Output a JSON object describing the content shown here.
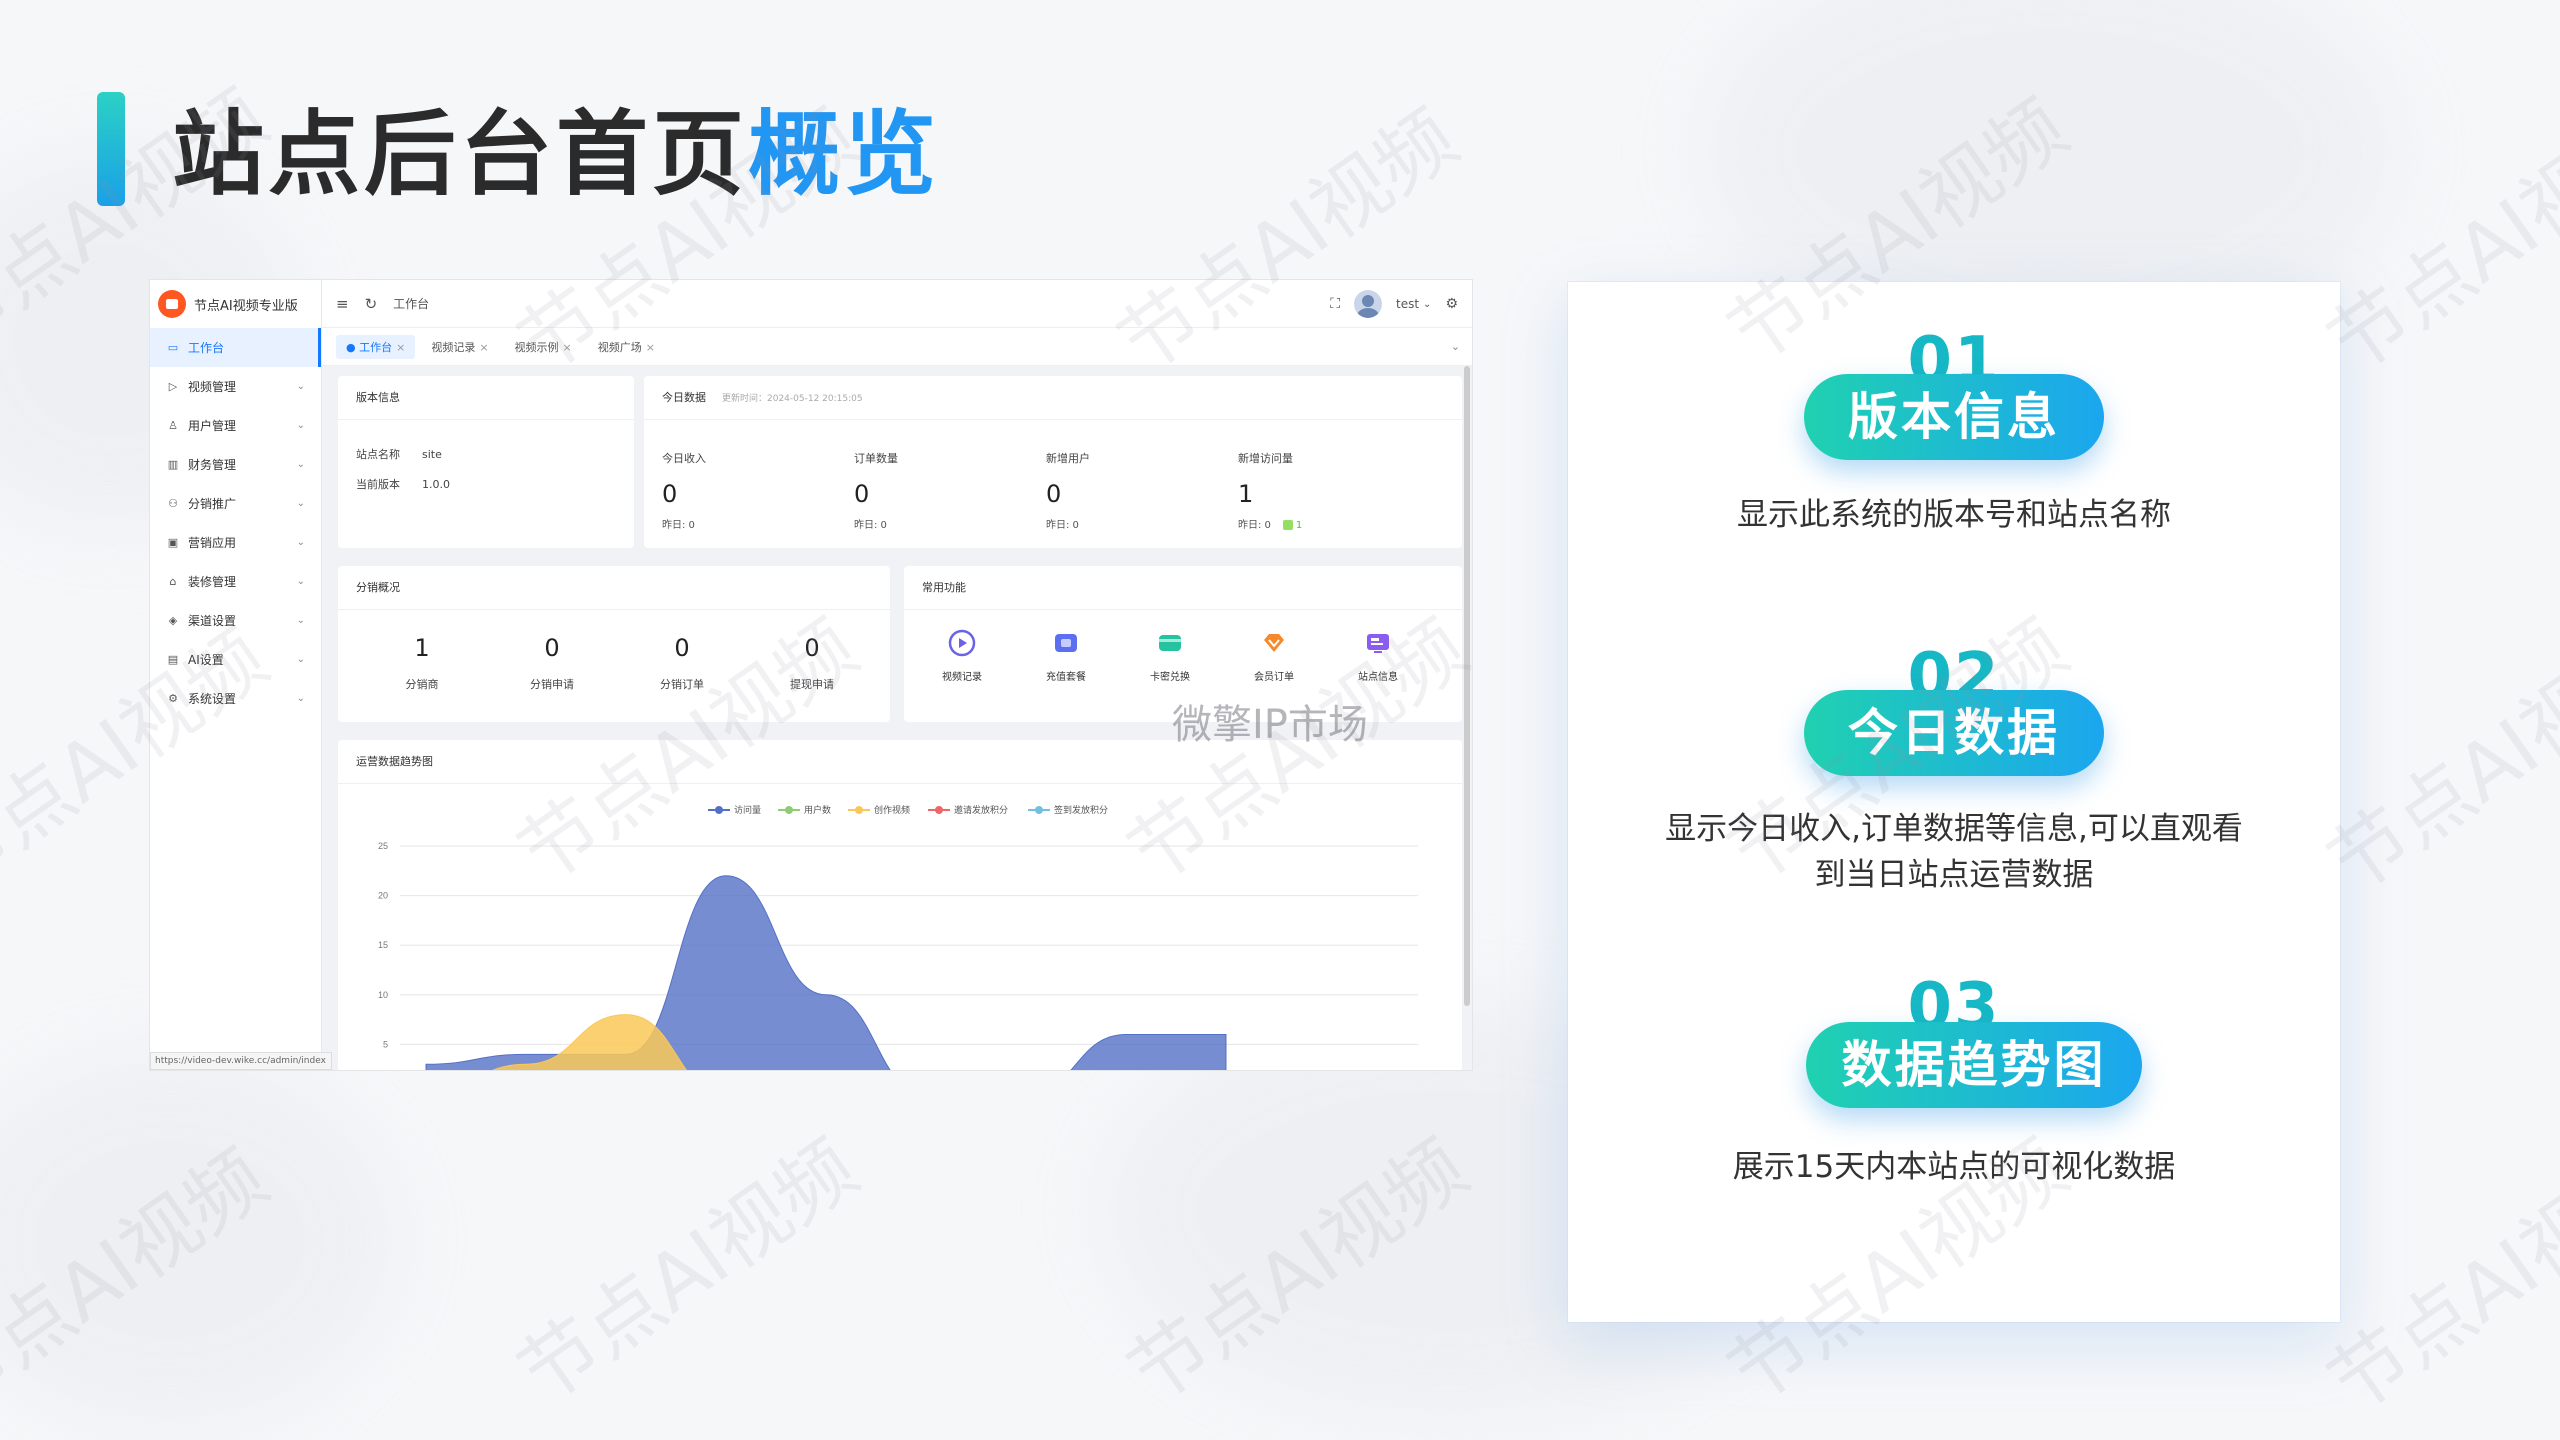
{
  "slide": {
    "title_main": "站点后台首页",
    "title_highlight": "概览",
    "watermark": "节点AI视频",
    "center_watermark": "微擎IP市场"
  },
  "admin": {
    "brand": "节点AI视频专业版",
    "menu": [
      {
        "label": "工作台",
        "icon": "monitor-icon",
        "active": true
      },
      {
        "label": "视频管理",
        "icon": "video-icon"
      },
      {
        "label": "用户管理",
        "icon": "user-icon"
      },
      {
        "label": "财务管理",
        "icon": "finance-icon"
      },
      {
        "label": "分销推广",
        "icon": "share-icon"
      },
      {
        "label": "营销应用",
        "icon": "gift-icon"
      },
      {
        "label": "装修管理",
        "icon": "decorate-icon"
      },
      {
        "label": "渠道设置",
        "icon": "channel-icon"
      },
      {
        "label": "AI设置",
        "icon": "ai-icon"
      },
      {
        "label": "系统设置",
        "icon": "gear-icon"
      }
    ],
    "url": "https://video-dev.wike.cc/admin/index",
    "topbar": {
      "breadcrumb": "工作台",
      "user": "test"
    },
    "tabs": [
      {
        "label": "工作台",
        "active": true
      },
      {
        "label": "视频记录"
      },
      {
        "label": "视频示例"
      },
      {
        "label": "视频广场"
      }
    ],
    "version_card": {
      "title": "版本信息",
      "site_name_label": "站点名称",
      "site_name": "site",
      "version_label": "当前版本",
      "version": "1.0.0"
    },
    "today_card": {
      "title": "今日数据",
      "updated": "更新时间：2024-05-12 20:15:05",
      "stats": [
        {
          "label": "今日收入",
          "value": "0",
          "yesterday": "昨日: 0"
        },
        {
          "label": "订单数量",
          "value": "0",
          "yesterday": "昨日: 0"
        },
        {
          "label": "新增用户",
          "value": "0",
          "yesterday": "昨日: 0"
        },
        {
          "label": "新增访问量",
          "value": "1",
          "yesterday": "昨日: 0",
          "delta": "1"
        }
      ]
    },
    "dist_card": {
      "title": "分销概况",
      "items": [
        {
          "value": "1",
          "label": "分销商"
        },
        {
          "value": "0",
          "label": "分销申请"
        },
        {
          "value": "0",
          "label": "分销订单"
        },
        {
          "value": "0",
          "label": "提现申请"
        }
      ]
    },
    "func_card": {
      "title": "常用功能",
      "items": [
        {
          "label": "视频记录",
          "icon": "play-icon",
          "color": "#6b63e6"
        },
        {
          "label": "充值套餐",
          "icon": "package-icon",
          "color": "#5b6ff0"
        },
        {
          "label": "卡密兑换",
          "icon": "card-icon",
          "color": "#27c2a0"
        },
        {
          "label": "会员订单",
          "icon": "diamond-icon",
          "color": "#f5892c"
        },
        {
          "label": "站点信息",
          "icon": "site-icon",
          "color": "#8a5cf0"
        }
      ]
    },
    "trend_card": {
      "title": "运营数据趋势图"
    }
  },
  "chart_data": {
    "type": "area",
    "title": "运营数据趋势图",
    "legend_position": "top-center",
    "series": [
      {
        "name": "访问量",
        "color": "#5470c6",
        "values": [
          3,
          4,
          4,
          22,
          10,
          0,
          0,
          6,
          6
        ]
      },
      {
        "name": "用户数",
        "color": "#91cc75",
        "values": [
          0,
          0,
          1,
          2,
          1,
          0,
          0,
          0,
          0
        ]
      },
      {
        "name": "创作视频",
        "color": "#fac858",
        "values": [
          0,
          3,
          8,
          0,
          0,
          0,
          0,
          0,
          0
        ]
      },
      {
        "name": "邀请发放积分",
        "color": "#ee6666",
        "values": [
          0,
          0,
          0,
          0,
          0,
          0,
          0,
          0,
          0
        ]
      },
      {
        "name": "签到发放积分",
        "color": "#73c0de",
        "values": [
          0,
          0,
          0,
          0,
          0,
          0,
          0,
          0,
          0
        ]
      }
    ],
    "yticks": [
      "25",
      "20",
      "15",
      "10",
      "5"
    ],
    "ylim": [
      0,
      25
    ]
  },
  "features": [
    {
      "num": "01",
      "title": "版本信息",
      "desc": "显示此系统的版本号和站点名称"
    },
    {
      "num": "02",
      "title": "今日数据",
      "desc": "显示今日收入,订单数据等信息,可以直观看到当日站点运营数据"
    },
    {
      "num": "03",
      "title": "数据趋势图",
      "desc": "展示15天内本站点的可视化数据"
    }
  ]
}
